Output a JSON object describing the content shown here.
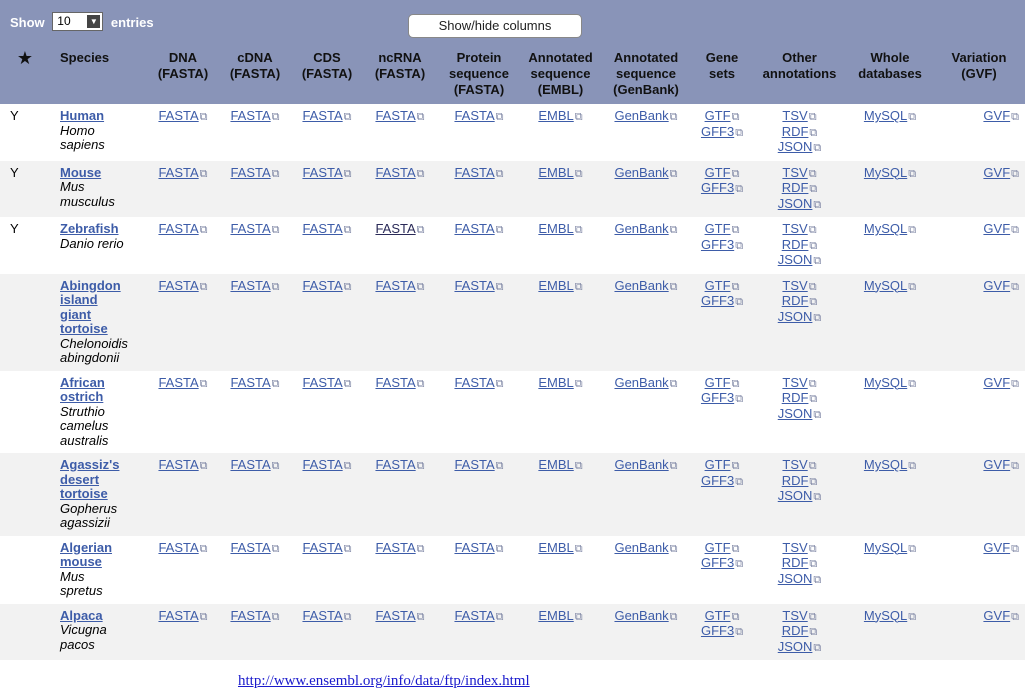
{
  "topbar": {
    "show_label": "Show",
    "entries_value": "10",
    "entries_label": "entries",
    "showhide_label": "Show/hide columns"
  },
  "headers": [
    [
      "★"
    ],
    [
      "Species"
    ],
    [
      "DNA",
      "(FASTA)"
    ],
    [
      "cDNA",
      "(FASTA)"
    ],
    [
      "CDS",
      "(FASTA)"
    ],
    [
      "ncRNA",
      "(FASTA)"
    ],
    [
      "Protein",
      "sequence",
      "(FASTA)"
    ],
    [
      "Annotated",
      "sequence",
      "(EMBL)"
    ],
    [
      "Annotated",
      "sequence",
      "(GenBank)"
    ],
    [
      "Gene",
      "sets"
    ],
    [
      "Other",
      "annotations"
    ],
    [
      "Whole",
      "databases"
    ],
    [
      "Variation",
      "(GVF)"
    ]
  ],
  "links": {
    "fasta": "FASTA",
    "embl": "EMBL",
    "genbank": "GenBank",
    "gtf": "GTF",
    "gff3": "GFF3",
    "tsv": "TSV",
    "rdf": "RDF",
    "json": "JSON",
    "mysql": "MySQL",
    "gvf": "GVF"
  },
  "rows": [
    {
      "fav": "Y",
      "common": [
        "Human"
      ],
      "sci": [
        "Homo",
        "sapiens"
      ]
    },
    {
      "fav": "Y",
      "common": [
        "Mouse"
      ],
      "sci": [
        "Mus",
        "musculus"
      ]
    },
    {
      "fav": "Y",
      "common": [
        "Zebrafish"
      ],
      "sci": [
        "Danio rerio"
      ]
    },
    {
      "fav": "",
      "common": [
        "Abingdon",
        "island",
        "giant",
        "tortoise"
      ],
      "sci": [
        "Chelonoidis",
        "abingdonii"
      ]
    },
    {
      "fav": "",
      "common": [
        "African",
        "ostrich"
      ],
      "sci": [
        "Struthio",
        "camelus",
        "australis"
      ]
    },
    {
      "fav": "",
      "common": [
        "Agassiz's",
        "desert",
        "tortoise"
      ],
      "sci": [
        "Gopherus",
        "agassizii"
      ]
    },
    {
      "fav": "",
      "common": [
        "Algerian",
        "mouse"
      ],
      "sci": [
        "Mus",
        "spretus"
      ]
    },
    {
      "fav": "",
      "common": [
        "Alpaca"
      ],
      "sci": [
        "Vicugna",
        "pacos"
      ]
    }
  ],
  "footer_url": "http://www.ensembl.org/info/data/ftp/index.html",
  "colors": {
    "header_bg": "#8994b8",
    "link": "#3d5ca8",
    "row_alt": "#f2f2f2",
    "url": "#1a1acc"
  },
  "icons": {
    "favourite": "star-icon",
    "external_link": "external-link-icon",
    "dropdown": "chevron-down-icon"
  }
}
